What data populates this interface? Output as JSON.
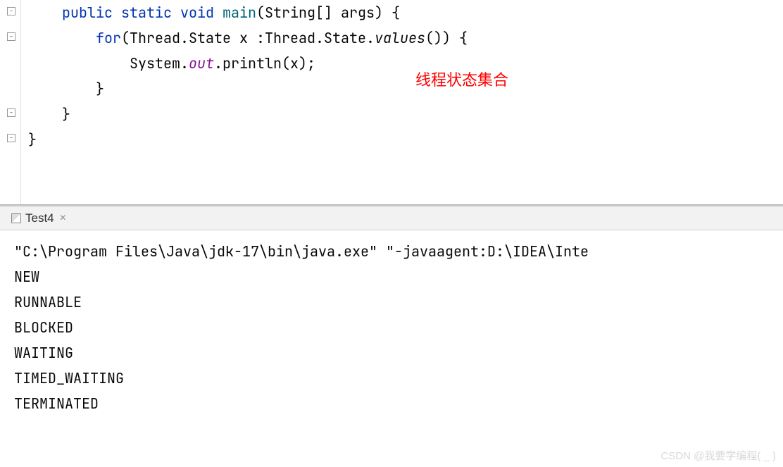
{
  "code": {
    "line1_pre": "    ",
    "kw_public": "public",
    "kw_static": "static",
    "kw_void": "void",
    "method_main": "main",
    "line1_post": "(String[] args) {",
    "line2_pre": "        ",
    "kw_for": "for",
    "line2_mid": "(Thread.State x :Thread.State.",
    "values_method": "values",
    "line2_post": "()) {",
    "line3_pre": "            System.",
    "out_field": "out",
    "line3_post": ".println(x);",
    "line4": "        }",
    "line5": "    }",
    "line6": "}"
  },
  "annotation": "线程状态集合",
  "tab": {
    "name": "Test4",
    "close": "×"
  },
  "console": {
    "command": "\"C:\\Program Files\\Java\\jdk-17\\bin\\java.exe\" \"-javaagent:D:\\IDEA\\Inte",
    "output": [
      "NEW",
      "RUNNABLE",
      "BLOCKED",
      "WAITING",
      "TIMED_WAITING",
      "TERMINATED"
    ]
  },
  "watermark": "CSDN @我要学编程( _ )"
}
